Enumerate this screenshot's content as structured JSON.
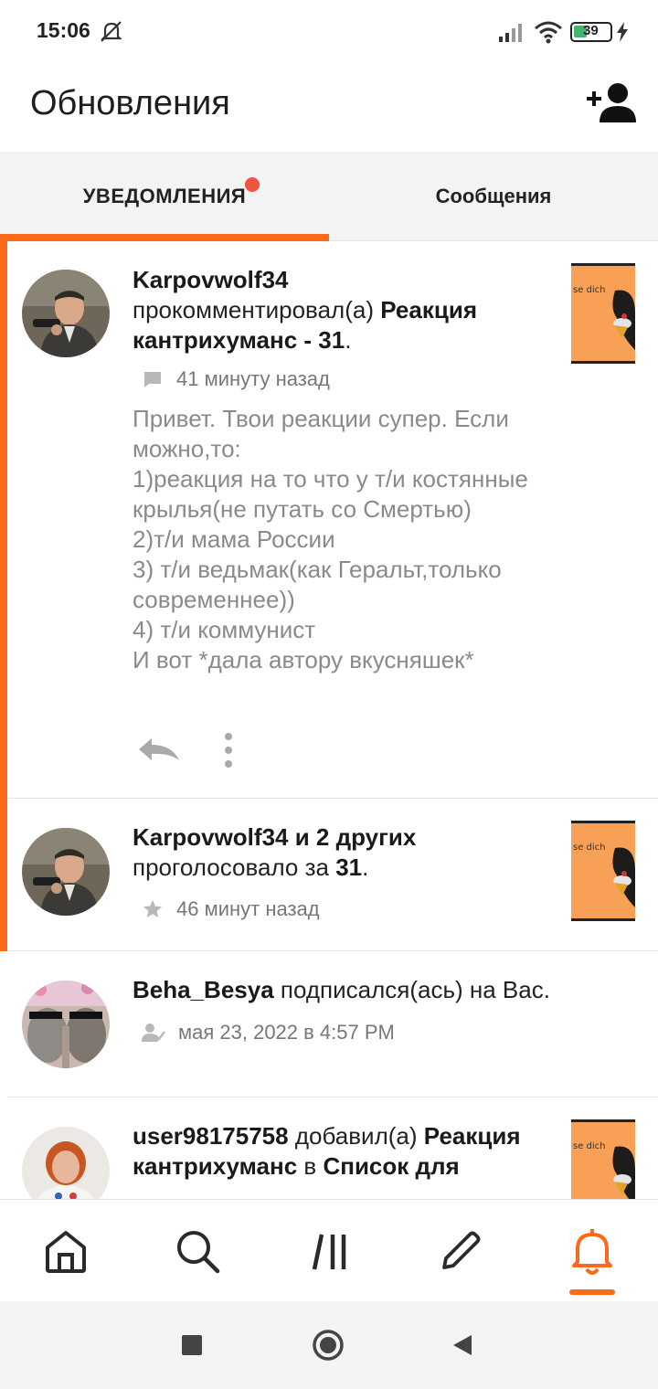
{
  "status": {
    "time": "15:06",
    "battery": "39"
  },
  "header": {
    "title": "Обновления"
  },
  "tabs": [
    {
      "label": "УВЕДОМЛЕНИЯ",
      "active": true,
      "has_dot": true
    },
    {
      "label": "Сообщения",
      "active": false
    }
  ],
  "notifications": [
    {
      "user": "Karpovwolf34",
      "action": "прокомментировал(а)",
      "target": "Реакция кантрихуманс - 31",
      "punct": ".",
      "time": "41 минуту назад",
      "comment": "Привет. Твои реакции супер. Если можно,то:\n1)реакция на то что у т/и костянные крылья(не путать со Смертью)\n2)т/и мама России\n3) т/и ведьмак(как Геральт,только современнее))\n4) т/и коммунист\nИ вот *дала автору вкусняшек*",
      "unread": true
    },
    {
      "user": "Karpovwolf34 и 2 других",
      "action": "проголосовало за",
      "target": "31",
      "punct": ".",
      "time": "46 минут назад",
      "unread": true
    },
    {
      "user": "Beha_Besya",
      "action": "подписался(ась) на Вас.",
      "time": "мая 23, 2022 в 4:57 PM",
      "unread": false
    },
    {
      "user": "user98175758",
      "action": "добавил(а)",
      "target": "Реакция кантрихуманс",
      "middle": "в",
      "target2": "Список для",
      "unread": false
    }
  ],
  "colors": {
    "accent": "#fb6a1b",
    "dot": "#f1533e",
    "thumb_bg": "#f8a055"
  },
  "icons": [
    "add-friend-icon",
    "comment-icon",
    "star-icon",
    "follow-icon",
    "reply-icon",
    "more-icon",
    "home-icon",
    "search-icon",
    "library-icon",
    "pencil-icon",
    "bell-icon"
  ]
}
